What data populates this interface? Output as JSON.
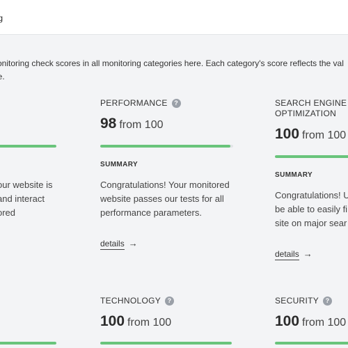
{
  "header": {
    "title": "ating"
  },
  "intro": {
    "line1": "monitoring check scores in all monitoring categories here. Each category's score reflects the val",
    "line2": "ore."
  },
  "summary_label": "SUMMARY",
  "details_label": "details",
  "arrow_icon": "→",
  "help_icon": "?",
  "from_label": "from 100",
  "accent_color": "#69c47b",
  "left_card": {
    "score_fragment": "",
    "text": [
      "our website is",
      "and interact",
      "ored"
    ]
  },
  "performance": {
    "title": "PERFORMANCE",
    "score": "98",
    "text": "Congratulations! Your monitored website passes our tests for all performance parameters."
  },
  "seo": {
    "title_line1": "SEARCH ENGINE",
    "title_line2": "OPTIMIZATION",
    "score": "100",
    "text": [
      "Congratulations! U",
      "be able to easily fi",
      "site on major sear"
    ]
  },
  "technology": {
    "title": "TECHNOLOGY",
    "score": "100"
  },
  "security": {
    "title": "SECURITY",
    "score": "100"
  },
  "bars": {
    "left_top": 1.0,
    "performance": 0.98,
    "seo": 1.0,
    "left_bottom": 1.0,
    "technology": 1.0,
    "security": 1.0
  }
}
